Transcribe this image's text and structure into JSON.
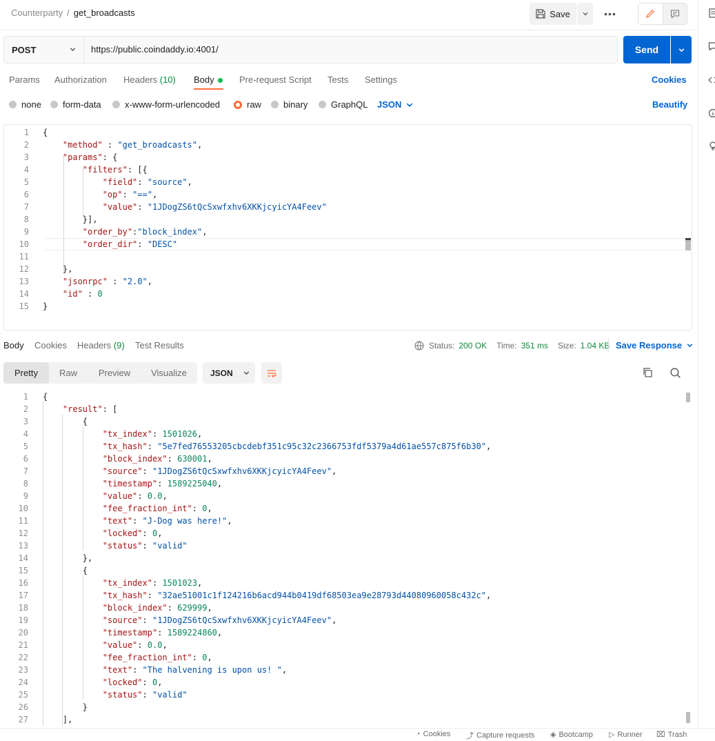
{
  "header": {
    "collection": "Counterparty",
    "separator": "/",
    "request_name": "get_broadcasts",
    "save_label": "Save",
    "more_label": "•••"
  },
  "request": {
    "method": "POST",
    "url": "https://public.coindaddy.io:4001/",
    "send_label": "Send"
  },
  "request_tabs": {
    "params": "Params",
    "authorization": "Authorization",
    "headers": "Headers",
    "headers_count": "(10)",
    "body": "Body",
    "prerequest": "Pre-request Script",
    "tests": "Tests",
    "settings": "Settings",
    "cookies": "Cookies"
  },
  "body_types": {
    "none": "none",
    "form_data": "form-data",
    "urlencoded": "x-www-form-urlencoded",
    "raw": "raw",
    "binary": "binary",
    "graphql": "GraphQL",
    "language": "JSON",
    "beautify": "Beautify"
  },
  "request_body_lines": [
    "{",
    "    \"method\" : \"get_broadcasts\",",
    "    \"params\": {",
    "        \"filters\": [{",
    "            \"field\": \"source\",",
    "            \"op\": \"==\",",
    "            \"value\": \"1JDogZS6tQcSxwfxhv6XKKjcyicYA4Feev\"",
    "        }],",
    "        \"order_by\":\"block_index\",",
    "        \"order_dir\": \"DESC\"",
    "",
    "    },",
    "    \"jsonrpc\" : \"2.0\",",
    "    \"id\" : 0",
    "}"
  ],
  "response_tabs": {
    "body": "Body",
    "cookies": "Cookies",
    "headers": "Headers",
    "headers_count": "(9)",
    "test_results": "Test Results"
  },
  "response_meta": {
    "status_label": "Status:",
    "status_value": "200 OK",
    "time_label": "Time:",
    "time_value": "351 ms",
    "size_label": "Size:",
    "size_value": "1.04 KB",
    "save_response": "Save Response"
  },
  "format_bar": {
    "pretty": "Pretty",
    "raw": "Raw",
    "preview": "Preview",
    "visualize": "Visualize",
    "language": "JSON"
  },
  "response_body_lines": [
    "{",
    "    \"result\": [",
    "        {",
    "            \"tx_index\": 1501026,",
    "            \"tx_hash\": \"5e7fed76553205cbcdebf351c95c32c2366753fdf5379a4d61ae557c875f6b30\",",
    "            \"block_index\": 630001,",
    "            \"source\": \"1JDogZS6tQcSxwfxhv6XKKjcyicYA4Feev\",",
    "            \"timestamp\": 1589225040,",
    "            \"value\": 0.0,",
    "            \"fee_fraction_int\": 0,",
    "            \"text\": \"J-Dog was here!\",",
    "            \"locked\": 0,",
    "            \"status\": \"valid\"",
    "        },",
    "        {",
    "            \"tx_index\": 1501023,",
    "            \"tx_hash\": \"32ae51001c1f124216b6acd944b0419df68503ea9e28793d44080960058c432c\",",
    "            \"block_index\": 629999,",
    "            \"source\": \"1JDogZS6tQcSxwfxhv6XKKjcyicYA4Feev\",",
    "            \"timestamp\": 1589224860,",
    "            \"value\": 0.0,",
    "            \"fee_fraction_int\": 0,",
    "            \"text\": \"The halvening is upon us! \",",
    "            \"locked\": 0,",
    "            \"status\": \"valid\"",
    "        }",
    "    ],"
  ],
  "status_bar": {
    "cookies": "Cookies",
    "capture": "Capture requests",
    "bootcamp": "Bootcamp",
    "runner": "Runner",
    "trash": "Trash"
  },
  "colors": {
    "accent": "#0265d2",
    "tab_indicator": "#ff6c37",
    "success": "#0a8a3a",
    "json_key": "#a31515",
    "json_string": "#0451a5",
    "json_number": "#098658"
  }
}
